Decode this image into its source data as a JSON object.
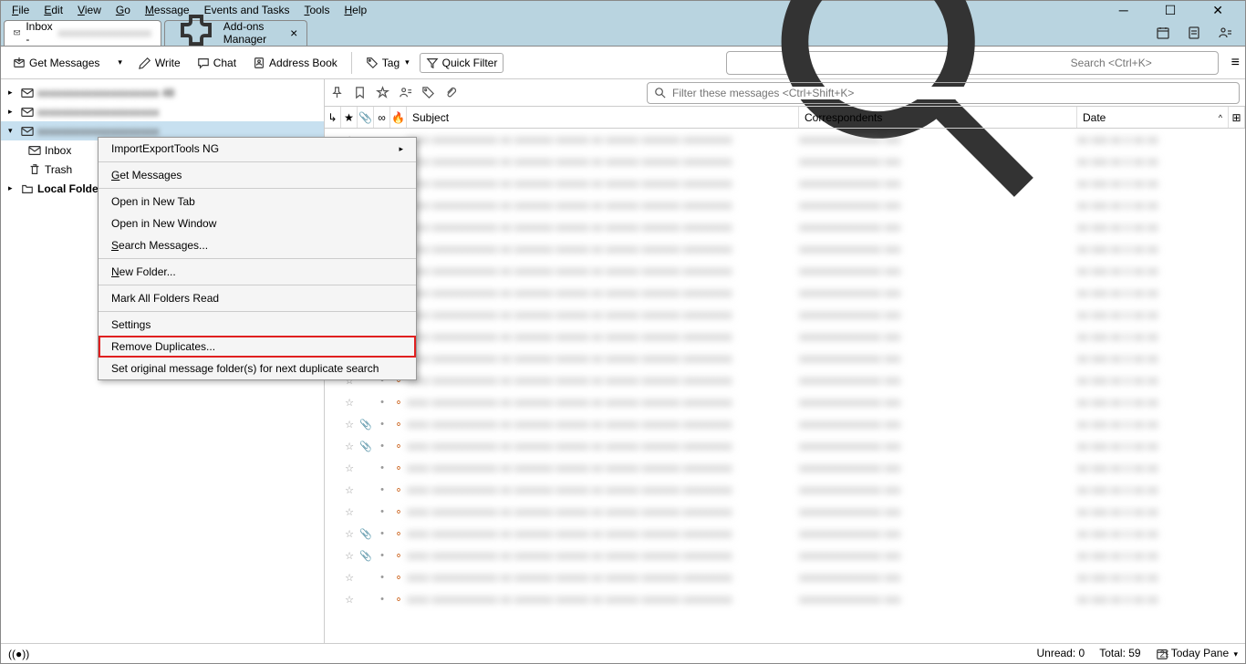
{
  "menu": {
    "file": "File",
    "edit": "Edit",
    "view": "View",
    "go": "Go",
    "message": "Message",
    "events": "Events and Tasks",
    "tools": "Tools",
    "help": "Help"
  },
  "tabs": {
    "inbox_prefix": "Inbox - ",
    "addons": "Add-ons Manager"
  },
  "toolbar": {
    "get": "Get Messages",
    "write": "Write",
    "chat": "Chat",
    "addressbook": "Address Book",
    "tag": "Tag",
    "quickfilter": "Quick Filter",
    "search_ph": "Search <Ctrl+K>"
  },
  "tree": {
    "inbox": "Inbox",
    "trash": "Trash",
    "local": "Local Folders"
  },
  "context": {
    "importexport": "ImportExportTools NG",
    "getmessages": "Get Messages",
    "newtab": "Open in New Tab",
    "newwindow": "Open in New Window",
    "search": "Search Messages...",
    "newfolder": "New Folder...",
    "markread": "Mark All Folders Read",
    "settings": "Settings",
    "removedup": "Remove Duplicates...",
    "setorig": "Set original message folder(s) for next duplicate search"
  },
  "filter_ph": "Filter these messages <Ctrl+Shift+K>",
  "columns": {
    "subject": "Subject",
    "correspondents": "Correspondents",
    "date": "Date"
  },
  "status": {
    "unread_lbl": "Unread:",
    "unread_val": "0",
    "total_lbl": "Total:",
    "total_val": "59",
    "today": "Today Pane"
  },
  "rows": [
    {
      "att": false
    },
    {
      "att": false
    },
    {
      "att": false
    },
    {
      "att": false
    },
    {
      "att": false
    },
    {
      "att": false
    },
    {
      "att": false
    },
    {
      "att": false
    },
    {
      "att": false
    },
    {
      "att": false
    },
    {
      "att": false
    },
    {
      "att": false
    },
    {
      "att": false
    },
    {
      "att": true
    },
    {
      "att": true
    },
    {
      "att": false
    },
    {
      "att": false
    },
    {
      "att": false
    },
    {
      "att": true
    },
    {
      "att": true
    },
    {
      "att": false
    },
    {
      "att": false
    }
  ]
}
